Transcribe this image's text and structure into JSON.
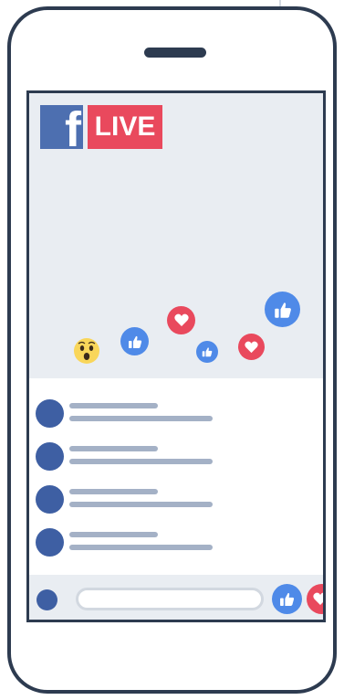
{
  "branding": {
    "logo_letter": "f",
    "live_label": "LIVE"
  },
  "colors": {
    "frame": "#2d3b50",
    "facebook_blue": "#4d6fb0",
    "live_red": "#e9495d",
    "like_blue": "#4f8ae8",
    "video_bg": "#e9edf2",
    "placeholder_text_line": "#a4b1c6",
    "avatar": "#3e5fa3"
  },
  "reactions": [
    {
      "type": "like"
    },
    {
      "type": "love"
    },
    {
      "type": "wow"
    }
  ],
  "comments": [
    {
      "item": 1
    },
    {
      "item": 2
    },
    {
      "item": 3
    },
    {
      "item": 4
    }
  ],
  "input": {
    "placeholder": ""
  }
}
